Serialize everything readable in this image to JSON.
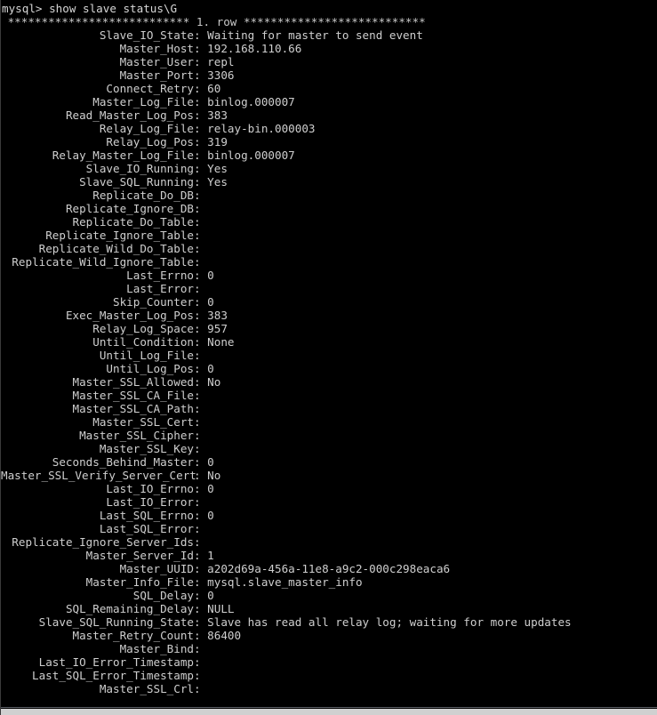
{
  "terminal": {
    "prompt": "mysql> ",
    "command": "show slave status\\G",
    "prompt_line": "mysql> show slave status\\G",
    "row_separator": " *************************** 1. row ***************************",
    "colors": {
      "background": "#000000",
      "foreground": "#cfcfcf",
      "scrollbar": "#dcdcdc",
      "border": "#5c5f66"
    }
  },
  "result": {
    "row_label": "1. row",
    "fields": [
      {
        "label": "Slave_IO_State",
        "value": "Waiting for master to send event"
      },
      {
        "label": "Master_Host",
        "value": "192.168.110.66"
      },
      {
        "label": "Master_User",
        "value": "repl"
      },
      {
        "label": "Master_Port",
        "value": "3306"
      },
      {
        "label": "Connect_Retry",
        "value": "60"
      },
      {
        "label": "Master_Log_File",
        "value": "binlog.000007"
      },
      {
        "label": "Read_Master_Log_Pos",
        "value": "383"
      },
      {
        "label": "Relay_Log_File",
        "value": "relay-bin.000003"
      },
      {
        "label": "Relay_Log_Pos",
        "value": "319"
      },
      {
        "label": "Relay_Master_Log_File",
        "value": "binlog.000007"
      },
      {
        "label": "Slave_IO_Running",
        "value": "Yes"
      },
      {
        "label": "Slave_SQL_Running",
        "value": "Yes"
      },
      {
        "label": "Replicate_Do_DB",
        "value": ""
      },
      {
        "label": "Replicate_Ignore_DB",
        "value": ""
      },
      {
        "label": "Replicate_Do_Table",
        "value": ""
      },
      {
        "label": "Replicate_Ignore_Table",
        "value": ""
      },
      {
        "label": "Replicate_Wild_Do_Table",
        "value": ""
      },
      {
        "label": "Replicate_Wild_Ignore_Table",
        "value": ""
      },
      {
        "label": "Last_Errno",
        "value": "0"
      },
      {
        "label": "Last_Error",
        "value": ""
      },
      {
        "label": "Skip_Counter",
        "value": "0"
      },
      {
        "label": "Exec_Master_Log_Pos",
        "value": "383"
      },
      {
        "label": "Relay_Log_Space",
        "value": "957"
      },
      {
        "label": "Until_Condition",
        "value": "None"
      },
      {
        "label": "Until_Log_File",
        "value": ""
      },
      {
        "label": "Until_Log_Pos",
        "value": "0"
      },
      {
        "label": "Master_SSL_Allowed",
        "value": "No"
      },
      {
        "label": "Master_SSL_CA_File",
        "value": ""
      },
      {
        "label": "Master_SSL_CA_Path",
        "value": ""
      },
      {
        "label": "Master_SSL_Cert",
        "value": ""
      },
      {
        "label": "Master_SSL_Cipher",
        "value": ""
      },
      {
        "label": "Master_SSL_Key",
        "value": ""
      },
      {
        "label": "Seconds_Behind_Master",
        "value": "0"
      },
      {
        "label": "Master_SSL_Verify_Server_Cert",
        "value": "No"
      },
      {
        "label": "Last_IO_Errno",
        "value": "0"
      },
      {
        "label": "Last_IO_Error",
        "value": ""
      },
      {
        "label": "Last_SQL_Errno",
        "value": "0"
      },
      {
        "label": "Last_SQL_Error",
        "value": ""
      },
      {
        "label": "Replicate_Ignore_Server_Ids",
        "value": ""
      },
      {
        "label": "Master_Server_Id",
        "value": "1"
      },
      {
        "label": "Master_UUID",
        "value": "a202d69a-456a-11e8-a9c2-000c298eaca6"
      },
      {
        "label": "Master_Info_File",
        "value": "mysql.slave_master_info"
      },
      {
        "label": "SQL_Delay",
        "value": "0"
      },
      {
        "label": "SQL_Remaining_Delay",
        "value": "NULL"
      },
      {
        "label": "Slave_SQL_Running_State",
        "value": "Slave has read all relay log; waiting for more updates"
      },
      {
        "label": "Master_Retry_Count",
        "value": "86400"
      },
      {
        "label": "Master_Bind",
        "value": ""
      },
      {
        "label": "Last_IO_Error_Timestamp",
        "value": ""
      },
      {
        "label": "Last_SQL_Error_Timestamp",
        "value": ""
      },
      {
        "label": "Master_SSL_Crl",
        "value": ""
      }
    ]
  }
}
